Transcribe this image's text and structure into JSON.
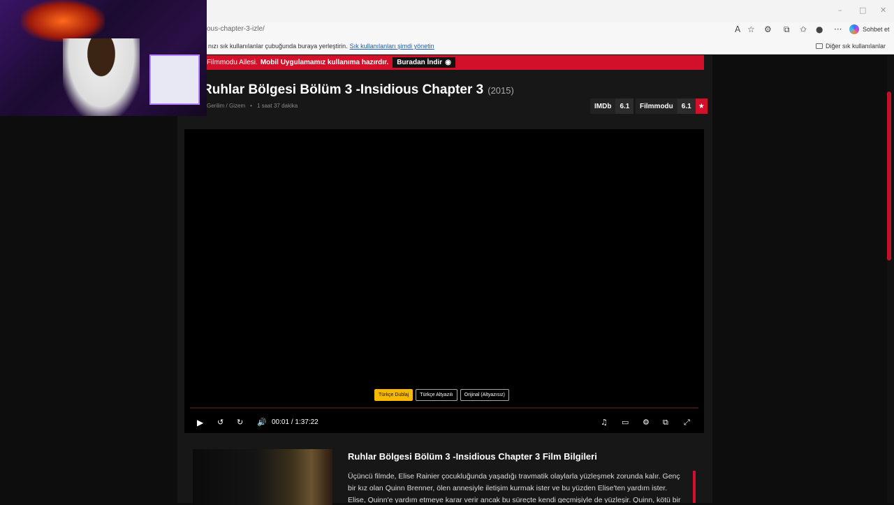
{
  "browser": {
    "url": "ous-chapter-3-izle/",
    "bookmarks_prompt": "nızı sık kullanılanlar çubuğunda buraya yerleştirin.",
    "bookmarks_link": "Sık kullanılanları şimdi yönetin",
    "other_bookmarks": "Diğer sık kullanılanlar",
    "copilot_label": "Sohbet et"
  },
  "banner": {
    "text": "Filmmodu Ailesi.",
    "bold_text": "Mobil Uygulamamız kullanıma hazırdır.",
    "download_label": "Buradan İndir"
  },
  "movie": {
    "title": "Ruhlar Bölgesi Bölüm 3 -Insidious Chapter 3",
    "year": "(2015)",
    "genres": "Gerilim / Gizem",
    "duration": "1 saat 37 dakika",
    "imdb_label": "IMDb",
    "imdb_score": "6.1",
    "site_label": "Filmmodu",
    "site_score": "6.1"
  },
  "player": {
    "languages": [
      "Türkçe Dublaj",
      "Türkçe Altyazılı",
      "Orijinal (Altyazısız)"
    ],
    "active_language": "Türkçe Dublaj",
    "current_time": "00:01",
    "separator": "/",
    "total_time": "1:37:22",
    "progress": 0.0002
  },
  "info": {
    "heading": "Ruhlar Bölgesi Bölüm 3 -Insidious Chapter 3 Film Bilgileri",
    "description": "Üçüncü filmde, Elise Rainier çocukluğunda yaşadığı travmatik olaylarla yüzleşmek zorunda kalır. Genç bir kız olan Quinn Brenner, ölen annesiyle iletişim kurmak ister ve bu yüzden Elise'ten yardım ister. Elise, Quinn'e yardım etmeye karar verir ancak bu süreçte kendi geçmişiyle de yüzleşir. Quinn, kötü bir ruh"
  },
  "colors": {
    "accent": "#d2102a",
    "active_lang": "#f6b800"
  }
}
